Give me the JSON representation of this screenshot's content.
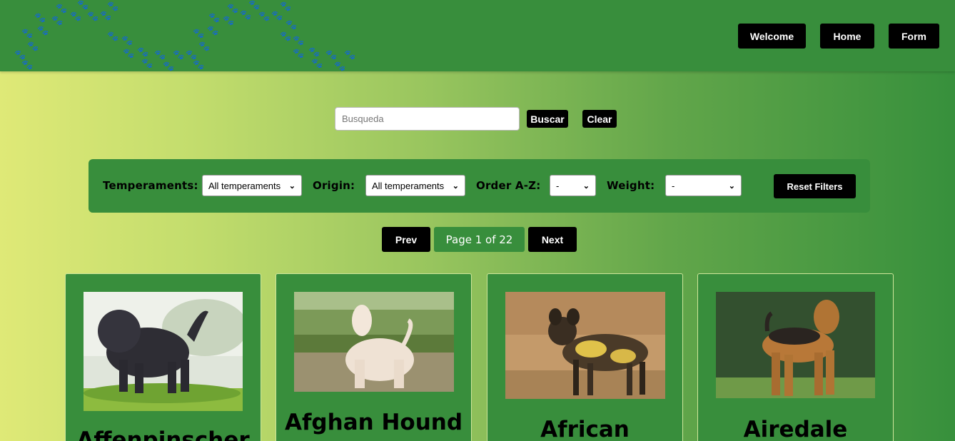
{
  "nav": {
    "welcome_label": "Welcome",
    "home_label": "Home",
    "form_label": "Form"
  },
  "search": {
    "placeholder": "Busqueda",
    "buscar_label": "Buscar",
    "clear_label": "Clear"
  },
  "filters": {
    "temperaments_label": "Temperaments:",
    "temperaments_value": "All temperaments",
    "origin_label": "Origin:",
    "origin_value": "All temperaments",
    "order_label": "Order A-Z:",
    "order_value": "-",
    "weight_label": "Weight:",
    "weight_value": "-",
    "reset_label": "Reset Filters"
  },
  "pagination": {
    "prev_label": "Prev",
    "page_text": "Page 1 of 22",
    "next_label": "Next"
  },
  "cards": [
    {
      "name": "Affenpinscher"
    },
    {
      "name": "Afghan Hound"
    },
    {
      "name": "African"
    },
    {
      "name": "Airedale"
    }
  ],
  "colors": {
    "navbar": "#388e3c",
    "button": "#000000",
    "gradient_start": "#dfe977",
    "gradient_end": "#37903c"
  }
}
